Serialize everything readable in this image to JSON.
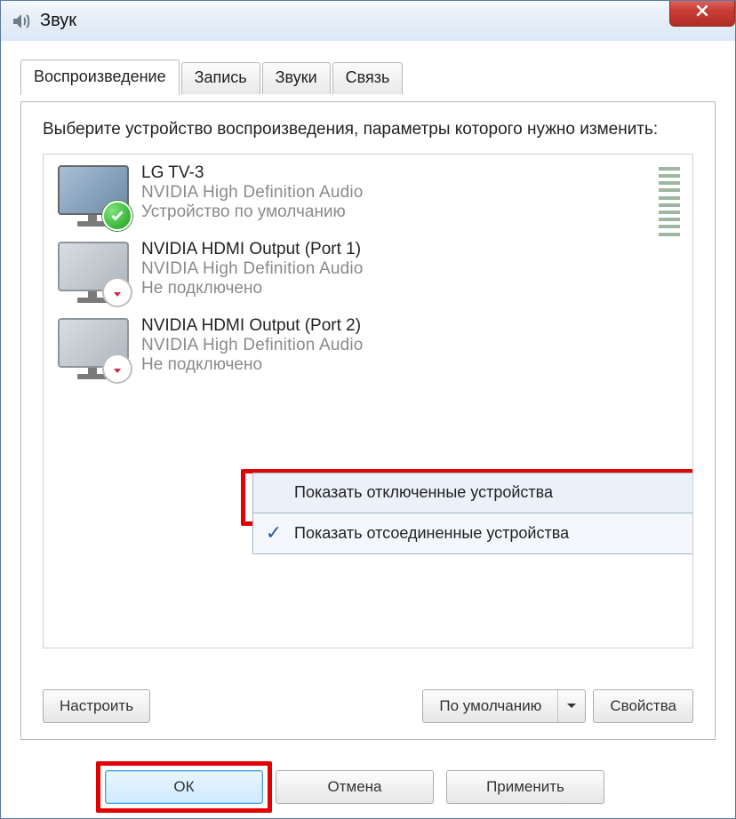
{
  "window": {
    "title": "Звук"
  },
  "tabs": [
    "Воспроизведение",
    "Запись",
    "Звуки",
    "Связь"
  ],
  "instruction": "Выберите устройство воспроизведения, параметры которого нужно изменить:",
  "devices": [
    {
      "name": "LG TV-3",
      "driver": "NVIDIA High Definition Audio",
      "status": "Устройство по умолчанию",
      "default": true
    },
    {
      "name": "NVIDIA HDMI Output (Port 1)",
      "driver": "NVIDIA High Definition Audio",
      "status": "Не подключено",
      "default": false
    },
    {
      "name": "NVIDIA HDMI Output (Port 2)",
      "driver": "NVIDIA High Definition Audio",
      "status": "Не подключено",
      "default": false
    }
  ],
  "context_menu": {
    "show_disabled": "Показать отключенные устройства",
    "show_disconnected": "Показать отсоединенные устройства"
  },
  "panel_buttons": {
    "configure": "Настроить",
    "set_default": "По умолчанию",
    "properties": "Свойства"
  },
  "dialog_buttons": {
    "ok": "ОК",
    "cancel": "Отмена",
    "apply": "Применить"
  }
}
